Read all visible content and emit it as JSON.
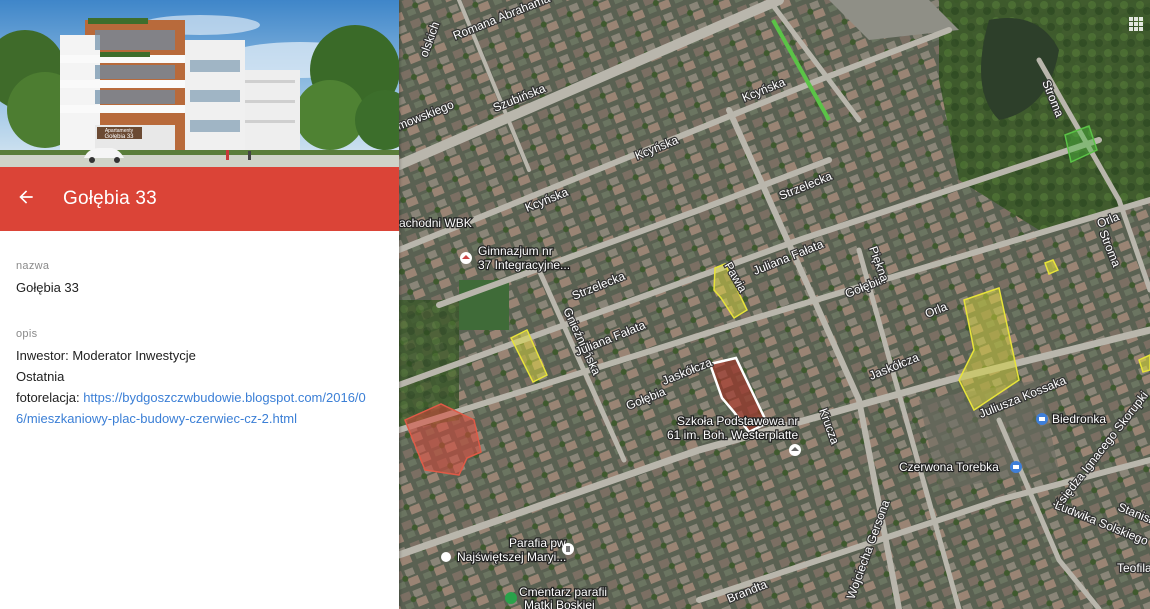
{
  "panel": {
    "header_title": "Gołębia 33",
    "photo_sign_line1": "Apartamenty",
    "photo_sign_line2": "Gołębia 33",
    "name_label": "nazwa",
    "name_value": "Gołębia 33",
    "desc_label": "opis",
    "desc_line1": "Inwestor: Moderator Inwestycje",
    "desc_line2": "Ostatnia",
    "desc_link_prefix": "fotorelacja: ",
    "desc_link": "https://bydgoszczwbudowie.blogspot.com/2016/06/mieszkaniowy-plac-budowy-czerwiec-cz-2.html"
  },
  "map": {
    "streets": [
      "Romana Abrahama",
      "Szubińska",
      "Kcyńska",
      "Kcyńska",
      "Kcyńska",
      "Strzelecka",
      "Strzelecka",
      "Gnieźnieńska",
      "Juliana Fałata",
      "Juliana Fałata",
      "Pawia",
      "Gołębia",
      "Gołębia",
      "Jaskółcza",
      "Jaskółcza",
      "Piękna",
      "Krucza",
      "Orla",
      "Orla",
      "Juliusza Kossaka",
      "Stroma",
      "Stroma",
      "Księdza Ignacego Skorupki",
      "Ludwika Solskiego",
      "Stanisła",
      "Teofila Ga",
      "Wojciecha Gersona",
      "Brandta",
      "olskich",
      "mowskiego"
    ],
    "pois": [
      "achodni WBK",
      "Gimnazjum nr",
      "37 Integracyjne...",
      "Szkoła Podstawowa nr",
      "61 im. Boh. Westerplatte",
      "Biedronka",
      "Czerwona Torebka",
      "Parafia pw.",
      "Najświętszej Maryi...",
      "Cmentarz parafii",
      "Matki Boskiej"
    ],
    "highlight_colors": {
      "selected": "#b5261e",
      "planned": "#e8e43a",
      "other": "#d9483a",
      "green_area": "#49b83c"
    },
    "icons": [
      "back-arrow-icon",
      "grid-apps-icon",
      "school-icon",
      "shop-icon",
      "church-icon",
      "cemetery-icon"
    ]
  }
}
